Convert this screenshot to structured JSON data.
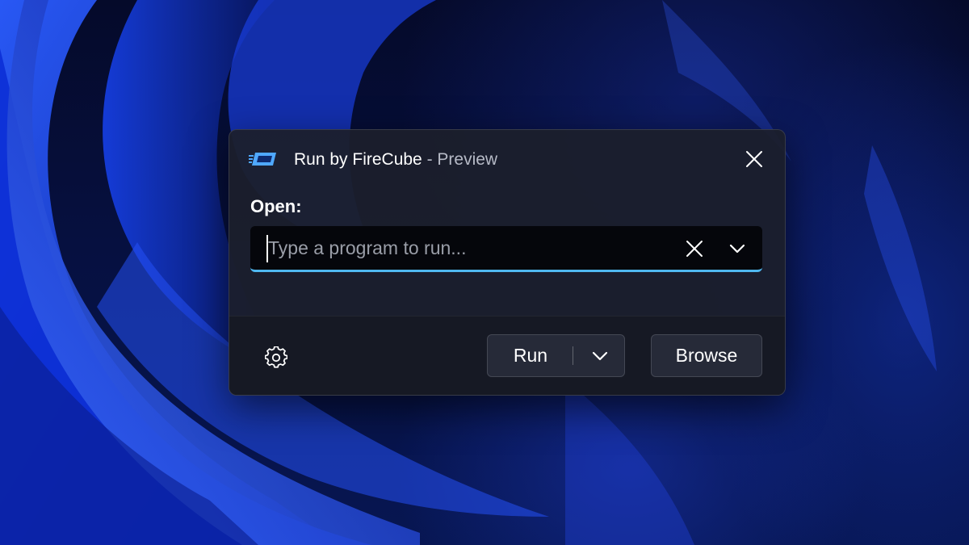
{
  "window": {
    "app_name": "Run by FireCube",
    "title_suffix": " - Preview",
    "app_icon": "firecube-run-icon",
    "close_icon": "close-icon"
  },
  "form": {
    "open_label": "Open:",
    "input_value": "",
    "input_placeholder": "Type a program to run...",
    "clear_icon": "clear-icon",
    "history_icon": "chevron-down-icon"
  },
  "footer": {
    "settings_icon": "gear-icon",
    "run_label": "Run",
    "run_dropdown_icon": "chevron-down-icon",
    "browse_label": "Browse"
  },
  "colors": {
    "accent": "#4fb8f0",
    "dialog_bg": "#1c1f2c",
    "button_bg": "#262a38"
  }
}
